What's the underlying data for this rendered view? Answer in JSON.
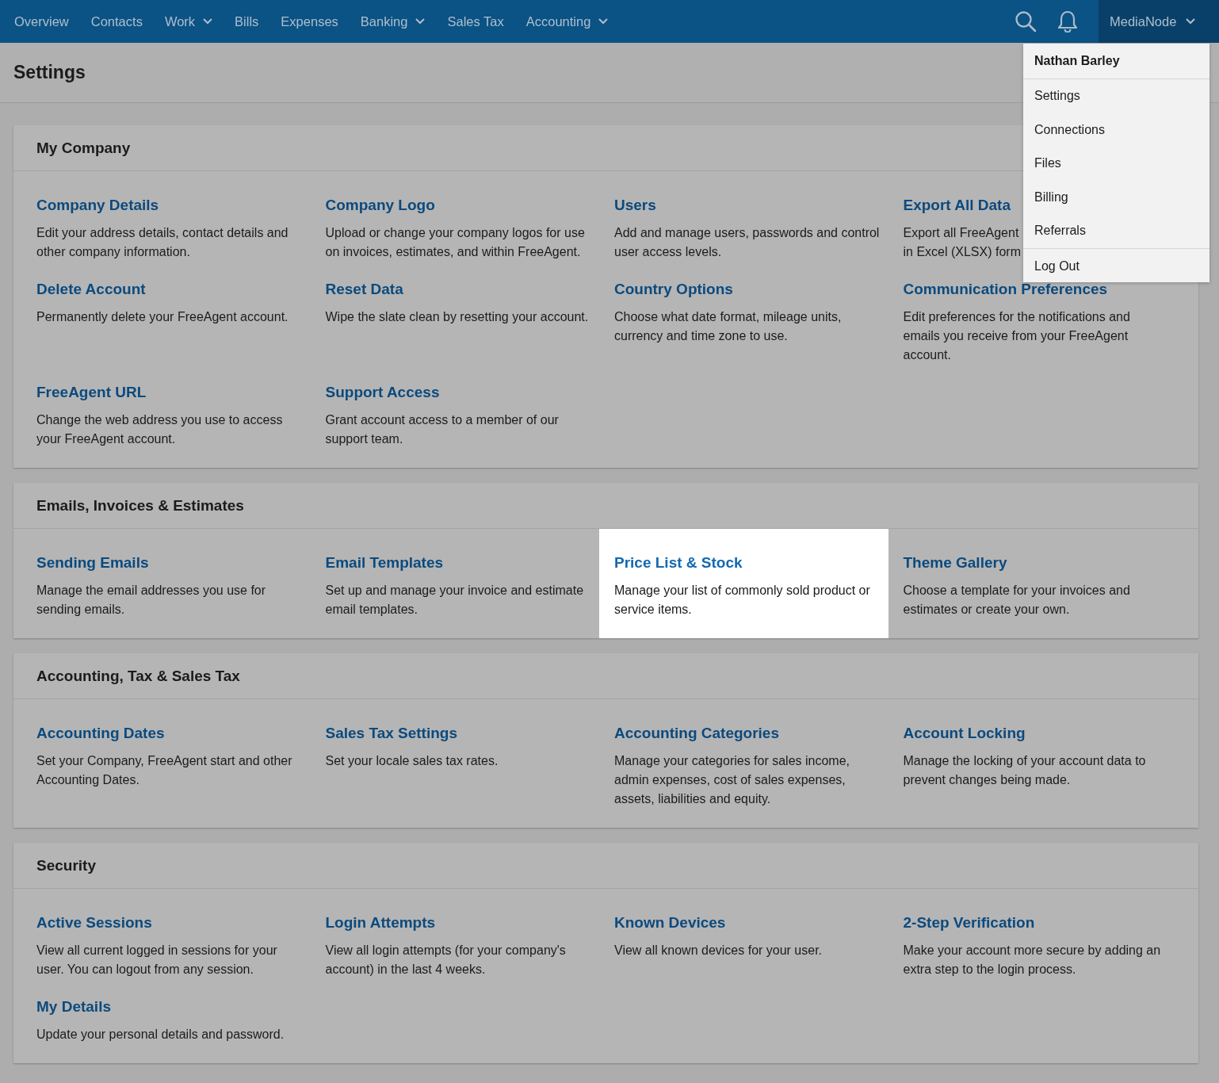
{
  "nav": {
    "items": [
      {
        "label": "Overview",
        "dropdown": false
      },
      {
        "label": "Contacts",
        "dropdown": false
      },
      {
        "label": "Work",
        "dropdown": true
      },
      {
        "label": "Bills",
        "dropdown": false
      },
      {
        "label": "Expenses",
        "dropdown": false
      },
      {
        "label": "Banking",
        "dropdown": true
      },
      {
        "label": "Sales Tax",
        "dropdown": false
      },
      {
        "label": "Accounting",
        "dropdown": true
      }
    ],
    "account": {
      "label": "MediaNode",
      "expanded": true
    }
  },
  "account_menu": {
    "user": "Nathan Barley",
    "items": [
      "Settings",
      "Connections",
      "Files",
      "Billing",
      "Referrals"
    ],
    "logout": "Log Out"
  },
  "page_title": "Settings",
  "sections": [
    {
      "title": "My Company",
      "items": [
        {
          "title": "Company Details",
          "description": "Edit your address details, contact details and other company information.",
          "highlighted": false
        },
        {
          "title": "Company Logo",
          "description": "Upload or change your company logos for use on invoices, estimates, and within FreeAgent.",
          "highlighted": false
        },
        {
          "title": "Users",
          "description": "Add and manage users, passwords and control user access levels.",
          "highlighted": false
        },
        {
          "title": "Export All Data",
          "description": "Export all FreeAgent\nin Excel (XLSX) form",
          "highlighted": false
        },
        {
          "title": "Delete Account",
          "description": "Permanently delete your FreeAgent account.",
          "highlighted": false
        },
        {
          "title": "Reset Data",
          "description": "Wipe the slate clean by resetting your account.",
          "highlighted": false
        },
        {
          "title": "Country Options",
          "description": "Choose what date format, mileage units, currency and time zone to use.",
          "highlighted": false
        },
        {
          "title": "Communication Preferences",
          "description": "Edit preferences for the notifications and emails you receive from your FreeAgent account.",
          "highlighted": false
        },
        {
          "title": "FreeAgent URL",
          "description": "Change the web address you use to access your FreeAgent account.",
          "highlighted": false
        },
        {
          "title": "Support Access",
          "description": "Grant account access to a member of our support team.",
          "highlighted": false
        }
      ]
    },
    {
      "title": "Emails, Invoices & Estimates",
      "items": [
        {
          "title": "Sending Emails",
          "description": "Manage the email addresses you use for sending emails.",
          "highlighted": false
        },
        {
          "title": "Email Templates",
          "description": "Set up and manage your invoice and estimate email templates.",
          "highlighted": false
        },
        {
          "title": "Price List & Stock",
          "description": "Manage your list of commonly sold product or service items.",
          "highlighted": true
        },
        {
          "title": "Theme Gallery",
          "description": "Choose a template for your invoices and estimates or create your own.",
          "highlighted": false
        }
      ]
    },
    {
      "title": "Accounting, Tax & Sales Tax",
      "items": [
        {
          "title": "Accounting Dates",
          "description": "Set your Company, FreeAgent start and other Accounting Dates.",
          "highlighted": false
        },
        {
          "title": "Sales Tax Settings",
          "description": "Set your locale sales tax rates.",
          "highlighted": false
        },
        {
          "title": "Accounting Categories",
          "description": "Manage your categories for sales income, admin expenses, cost of sales expenses, assets, liabilities and equity.",
          "highlighted": false
        },
        {
          "title": "Account Locking",
          "description": "Manage the locking of your account data to prevent changes being made.",
          "highlighted": false
        }
      ]
    },
    {
      "title": "Security",
      "items": [
        {
          "title": "Active Sessions",
          "description": "View all current logged in sessions for your user. You can logout from any session.",
          "highlighted": false
        },
        {
          "title": "Login Attempts",
          "description": "View all login attempts (for your company's account) in the last 4 weeks.",
          "highlighted": false
        },
        {
          "title": "Known Devices",
          "description": "View all known devices for your user.",
          "highlighted": false
        },
        {
          "title": "2-Step Verification",
          "description": "Make your account more secure by adding an extra step to the login process.",
          "highlighted": false
        },
        {
          "title": "My Details",
          "description": "Update your personal details and password.",
          "highlighted": false
        }
      ]
    }
  ]
}
